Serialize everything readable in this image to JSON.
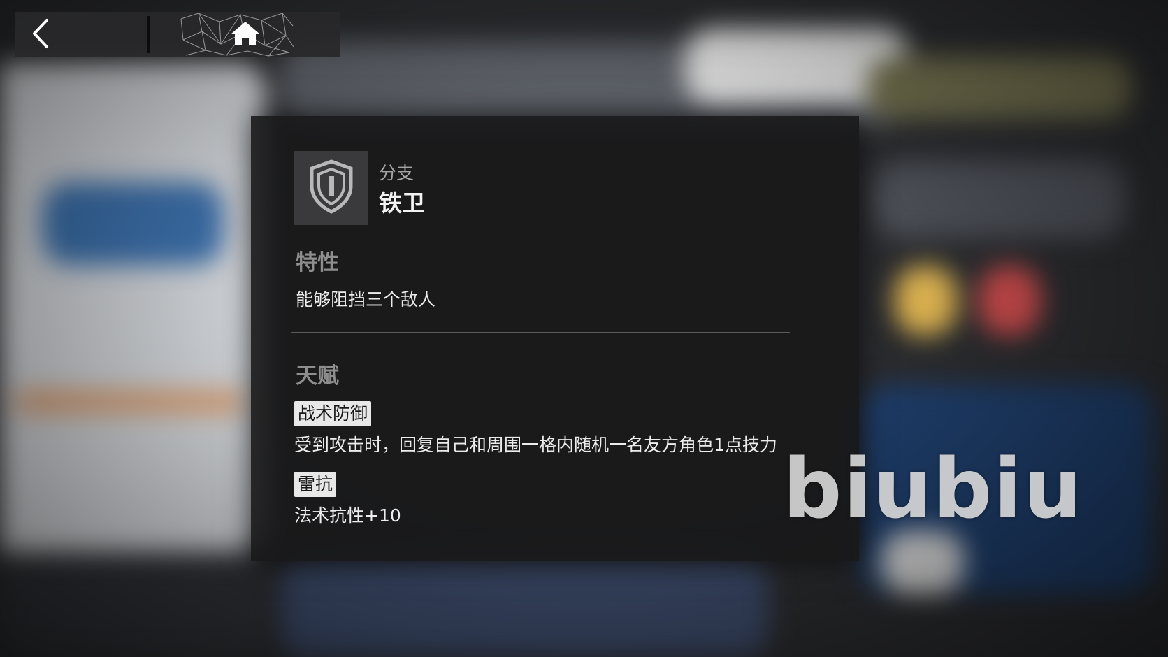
{
  "topnav": {
    "back_icon": "chevron-left-icon",
    "home_icon": "home-icon"
  },
  "branch": {
    "label": "分支",
    "name": "铁卫",
    "icon": "shield-icon"
  },
  "trait": {
    "title": "特性",
    "description": "能够阻挡三个敌人"
  },
  "talent": {
    "title": "天赋",
    "items": [
      {
        "name": "战术防御",
        "description": "受到攻击时，回复自己和周围一格内随机一名友方角色1点技力"
      },
      {
        "name": "雷抗",
        "description": "法术抗性+10"
      }
    ]
  },
  "watermark": "biubiu",
  "colors": {
    "panel_bg": "#18181a",
    "tag_bg": "#e8e8e8",
    "section_title": "#8e8e8e"
  }
}
